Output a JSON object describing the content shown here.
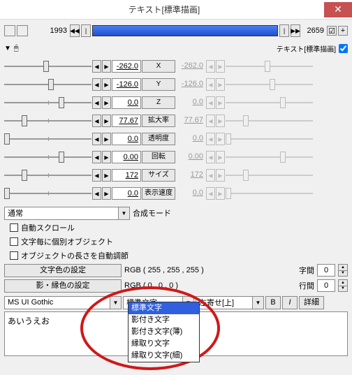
{
  "window": {
    "title": "テキスト[標準描画]"
  },
  "timeline": {
    "start": "1993",
    "end": "2659",
    "label": "テキスト[標準描画]"
  },
  "params": [
    {
      "name": "X",
      "v1": "-262.0",
      "v2": "-262.0",
      "t1": 45,
      "t2": 45
    },
    {
      "name": "Y",
      "v1": "-126.0",
      "v2": "-126.0",
      "t1": 50,
      "t2": 50
    },
    {
      "name": "Z",
      "v1": "0.0",
      "v2": "0.0",
      "t1": 62,
      "t2": 62
    },
    {
      "name": "拡大率",
      "v1": "77.67",
      "v2": "77.67",
      "t1": 20,
      "t2": 20
    },
    {
      "name": "透明度",
      "v1": "0.0",
      "v2": "0.0",
      "t1": 0,
      "t2": 0
    },
    {
      "name": "回転",
      "v1": "0.00",
      "v2": "0.00",
      "t1": 62,
      "t2": 62
    },
    {
      "name": "サイズ",
      "v1": "172",
      "v2": "172",
      "t1": 20,
      "t2": 20
    },
    {
      "name": "表示速度",
      "v1": "0.0",
      "v2": "0.0",
      "t1": 0,
      "t2": 0
    }
  ],
  "blend": {
    "value": "通常",
    "label": "合成モード"
  },
  "checks": {
    "c1": "自動スクロール",
    "c2": "文字毎に個別オブジェクト",
    "c3": "オブジェクトの長さを自動調節"
  },
  "colors": {
    "text_btn": "文字色の設定",
    "text_val": "RGB ( 255 , 255 , 255 )",
    "shadow_btn": "影・縁色の設定",
    "shadow_val": "RGB ( 0 , 0 , 0 )",
    "spacing": "字間",
    "spacing_v": "0",
    "line": "行間",
    "line_v": "0"
  },
  "font": {
    "name": "MS UI Gothic",
    "style": "標準文字",
    "align": "左寄せ[上]",
    "b": "B",
    "i": "I",
    "detail": "詳細"
  },
  "style_options": [
    "標準文字",
    "影付き文字",
    "影付き文字(薄)",
    "縁取り文字",
    "縁取り文字(細)"
  ],
  "text_content": "あいうえお"
}
